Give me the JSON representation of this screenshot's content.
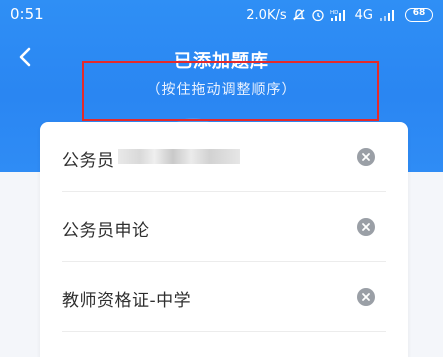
{
  "status_bar": {
    "time": "0:51",
    "network_speed": "2.0K/s",
    "network_type": "4G",
    "battery": "68"
  },
  "header": {
    "title": "已添加题库",
    "subtitle": "（按住拖动调整顺序）"
  },
  "bank_list": [
    {
      "label": "公务员行测",
      "obscured": true
    },
    {
      "label": "公务员申论"
    },
    {
      "label": "教师资格证-中学"
    }
  ]
}
